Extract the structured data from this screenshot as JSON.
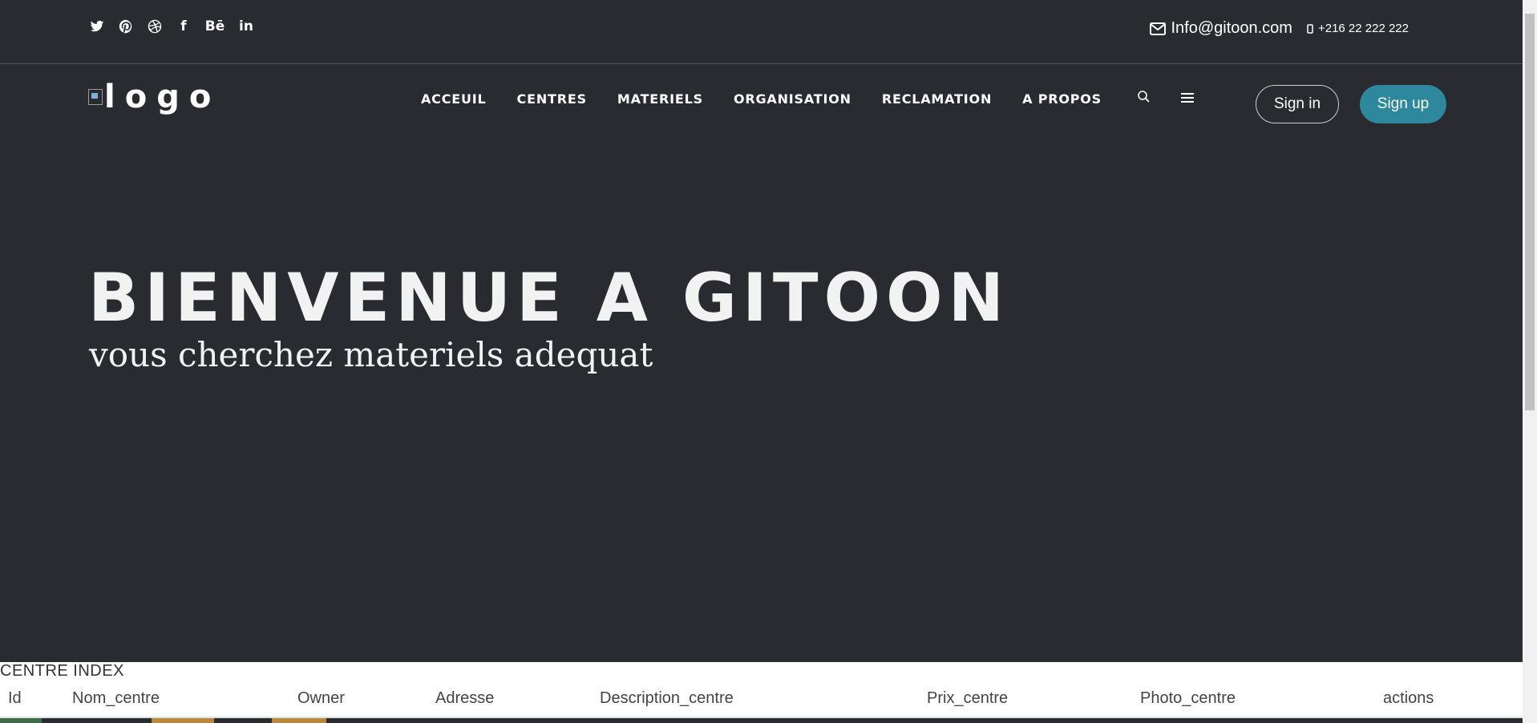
{
  "socials": [
    {
      "icon": "twitter-icon"
    },
    {
      "icon": "pinterest-icon"
    },
    {
      "icon": "dribbble-icon"
    },
    {
      "icon": "facebook-icon",
      "glyph": "f"
    },
    {
      "icon": "behance-icon",
      "glyph": "Bē"
    },
    {
      "icon": "linkedin-icon",
      "glyph": "in"
    }
  ],
  "contact": {
    "email": "Info@gitoon.com",
    "phone": "+216 22 222 222"
  },
  "logo": {
    "text": "logo"
  },
  "nav": {
    "items": [
      "ACCEUIL",
      "CENTRES",
      "MATERIELS",
      "ORGANISATION",
      "RECLAMATION",
      "A PROPOS"
    ]
  },
  "auth": {
    "signin_label": "Sign in",
    "signup_label": "Sign up"
  },
  "hero": {
    "title": "BIENVENUE A GITOON",
    "subtitle": "vous cherchez materiels adequat"
  },
  "section": {
    "title": "CENTRE INDEX"
  },
  "table": {
    "columns": [
      "Id",
      "Nom_centre",
      "Owner",
      "Adresse",
      "Description_centre",
      "Prix_centre",
      "Photo_centre",
      "actions"
    ]
  },
  "colors": {
    "hero_bg": "#2a2b30",
    "accent": "#2d889d"
  }
}
